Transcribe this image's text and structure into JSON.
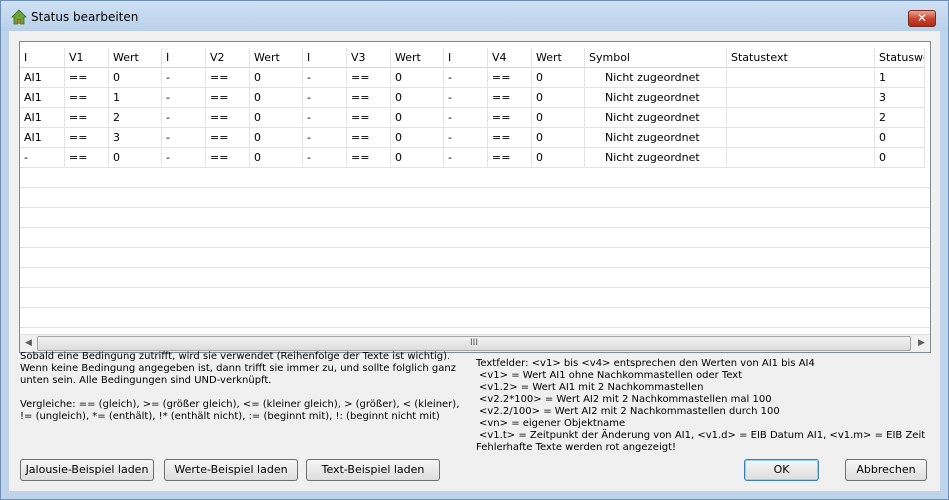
{
  "window": {
    "title": "Status bearbeiten",
    "close_glyph": "✕"
  },
  "table": {
    "headers": [
      "I",
      "V1",
      "Wert",
      "I",
      "V2",
      "Wert",
      "I",
      "V3",
      "Wert",
      "I",
      "V4",
      "Wert",
      "Symbol",
      "Statustext",
      "Statuswe"
    ],
    "rows": [
      [
        "AI1",
        "==",
        "0",
        "-",
        "==",
        "0",
        "-",
        "==",
        "0",
        "-",
        "==",
        "0",
        "Nicht zugeordnet",
        "",
        "1"
      ],
      [
        "AI1",
        "==",
        "1",
        "-",
        "==",
        "0",
        "-",
        "==",
        "0",
        "-",
        "==",
        "0",
        "Nicht zugeordnet",
        "",
        "3"
      ],
      [
        "AI1",
        "==",
        "2",
        "-",
        "==",
        "0",
        "-",
        "==",
        "0",
        "-",
        "==",
        "0",
        "Nicht zugeordnet",
        "",
        "2"
      ],
      [
        "AI1",
        "==",
        "3",
        "-",
        "==",
        "0",
        "-",
        "==",
        "0",
        "-",
        "==",
        "0",
        "Nicht zugeordnet",
        "",
        "0"
      ],
      [
        "-",
        "==",
        "0",
        "-",
        "==",
        "0",
        "-",
        "==",
        "0",
        "-",
        "==",
        "0",
        "Nicht zugeordnet",
        "",
        "0"
      ]
    ],
    "scroll_left": "◀",
    "scroll_right": "▶",
    "scroll_grip": "III"
  },
  "help": {
    "rules": "Sobald eine Bedingung zutrifft, wird sie verwendet (Reihenfolge der Texte ist wichtig). Wenn keine Bedingung angegeben ist, dann trifft sie immer zu, und sollte folglich ganz unten sein. Alle Bedingungen sind UND-verknüpft.",
    "compare": "Vergleiche: == (gleich), >= (größer gleich), <= (kleiner gleich), > (größer), < (kleiner), != (ungleich), *= (enthält), !* (enthält nicht), := (beginnt mit), !: (beginnt nicht mit)",
    "textfields": [
      "Textfelder: <v1> bis <v4> entsprechen den Werten von AI1 bis AI4",
      "<v1> = Wert AI1 ohne Nachkommastellen oder Text",
      "<v1.2> = Wert AI1 mit 2 Nachkommastellen",
      "<v2.2*100> = Wert AI2 mit 2 Nachkommastellen mal 100",
      "<v2.2/100> = Wert AI2 mit 2 Nachkommastellen durch 100",
      "<vn> = eigener Objektname",
      "<v1.t> = Zeitpunkt der Änderung von AI1, <v1.d> = EIB Datum AI1, <v1.m> = EIB Zeit",
      "Fehlerhafte Texte werden rot angezeigt!"
    ]
  },
  "buttons": {
    "jalousie": "Jalousie-Beispiel laden",
    "werte": "Werte-Beispiel laden",
    "text": "Text-Beispiel laden",
    "ok": "OK",
    "cancel": "Abbrechen"
  }
}
